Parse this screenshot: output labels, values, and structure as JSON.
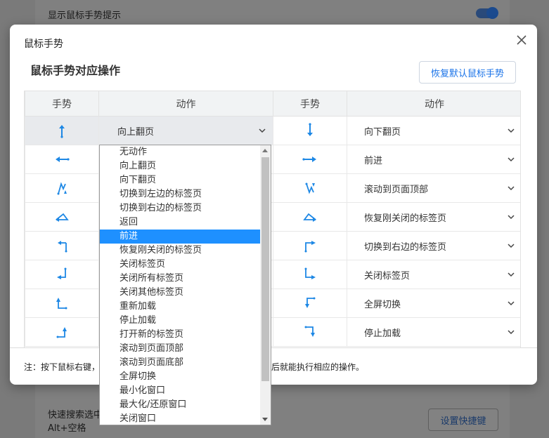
{
  "background": {
    "setting_top": "显示鼠标手势提示",
    "setting_bottom": "快速搜索选中",
    "setting_bottom_sub": "Alt+空格",
    "shortcut_button": "设置快捷键"
  },
  "dialog": {
    "title": "鼠标手势",
    "subtitle": "鼠标手势对应操作",
    "restore_button": "恢复默认鼠标手势",
    "headers": [
      "手势",
      "动作",
      "手势",
      "动作"
    ],
    "rows": [
      {
        "left_gesture": "up-arrow-icon",
        "left_action": "向上翻页",
        "right_gesture": "down-arrow-icon",
        "right_action": "向下翻页"
      },
      {
        "left_gesture": "left-arrow-icon",
        "left_action": "",
        "right_gesture": "right-arrow-icon",
        "right_action": "前进"
      },
      {
        "left_gesture": "down-up-icon",
        "left_action": "",
        "right_gesture": "up-down-icon",
        "right_action": "滚动到页面顶部"
      },
      {
        "left_gesture": "right-left-icon",
        "left_action": "",
        "right_gesture": "left-right-icon",
        "right_action": "恢复刚关闭的标签页"
      },
      {
        "left_gesture": "left-down-icon",
        "left_action": "",
        "right_gesture": "up-right-icon",
        "right_action": "切换到右边的标签页"
      },
      {
        "left_gesture": "down-left-icon",
        "left_action": "",
        "right_gesture": "down-right-icon",
        "right_action": "关闭标签页"
      },
      {
        "left_gesture": "up-right-turn-icon",
        "left_action": "",
        "right_gesture": "left-down-turn-icon",
        "right_action": "全屏切换"
      },
      {
        "left_gesture": "right-up-icon",
        "left_action": "",
        "right_gesture": "right-down-icon",
        "right_action": "停止加载"
      }
    ],
    "note_left": "注：按下鼠标右键，",
    "note_right": "后就能执行相应的操作。"
  },
  "dropdown": {
    "selected_index": 6,
    "options": [
      "无动作",
      "向上翻页",
      "向下翻页",
      "切换到左边的标签页",
      "切换到右边的标签页",
      "返回",
      "前进",
      "恢复刚关闭的标签页",
      "关闭标签页",
      "关闭所有标签页",
      "关闭其他标签页",
      "重新加载",
      "停止加载",
      "打开新的标签页",
      "滚动到页面顶部",
      "滚动到页面底部",
      "全屏切换",
      "最小化窗口",
      "最大化/还原窗口",
      "关闭窗口"
    ]
  },
  "colors": {
    "accent": "#1a73e8",
    "gesture": "#1e88e5",
    "highlight": "#1e90ff"
  }
}
